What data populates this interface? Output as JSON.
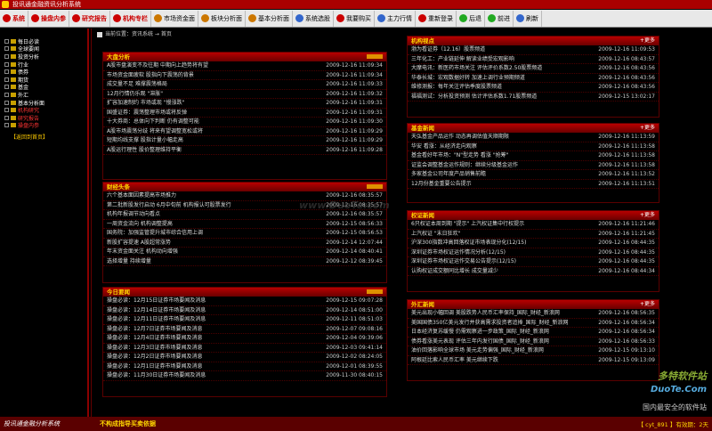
{
  "window": {
    "title": "投讯通金融资讯分析系统"
  },
  "toolbar": [
    {
      "label": "系统",
      "color": "#c00",
      "red": true
    },
    {
      "label": "操盘内参",
      "color": "#c00",
      "red": true
    },
    {
      "label": "研究报告",
      "color": "#c00",
      "red": true
    },
    {
      "label": "机构专栏",
      "color": "#c00",
      "red": true
    },
    {
      "label": "市场资金面",
      "color": "#c70",
      "red": false
    },
    {
      "label": "板块分析面",
      "color": "#c70",
      "red": false
    },
    {
      "label": "基本分析面",
      "color": "#c70",
      "red": false
    },
    {
      "label": "系统选股",
      "color": "#36c",
      "red": false
    },
    {
      "label": "我要购买",
      "color": "#c00",
      "red": false
    },
    {
      "label": "主力行情",
      "color": "#36c",
      "red": false
    },
    {
      "label": "重新登录",
      "color": "#c00",
      "red": false
    },
    {
      "label": "后退",
      "color": "#2a2",
      "red": false
    },
    {
      "label": "前进",
      "color": "#2a2",
      "red": false
    },
    {
      "label": "刷新",
      "color": "#36c",
      "red": false
    }
  ],
  "sidebar": {
    "items": [
      {
        "label": "每日必读",
        "red": false
      },
      {
        "label": "全球要闻",
        "red": false
      },
      {
        "label": "投资分析",
        "red": false
      },
      {
        "label": "行业",
        "red": false
      },
      {
        "label": "债券",
        "red": false
      },
      {
        "label": "期货",
        "red": false
      },
      {
        "label": "基金",
        "red": false
      },
      {
        "label": "外汇",
        "red": false
      },
      {
        "label": "基本分析面",
        "red": false
      },
      {
        "label": "机构研究",
        "red": true
      },
      {
        "label": "研究报告",
        "red": true
      },
      {
        "label": "操盘内参",
        "red": true
      }
    ],
    "back_link": "【返回到首页】"
  },
  "breadcrumb": {
    "text": "当前位置：资讯系统 → 首页"
  },
  "panels": {
    "dapan": {
      "title": "大盘分析",
      "more": "",
      "rows": [
        {
          "t": "A股市盘演变不及往期 中期向上趋势将有望",
          "d": "2009-12-16 11:09:34"
        },
        {
          "t": "市场资金面疲软 股指向下震荡的背景",
          "d": "2009-12-16 11:09:34"
        },
        {
          "t": "成交量不足 难撑震荡格局",
          "d": "2009-12-16 11:09:33"
        },
        {
          "t": "12月行情仍乐观 \"滞胀\"",
          "d": "2009-12-16 11:09:32"
        },
        {
          "t": "扩容加速制约 市场或现 \"慢涨跌\"",
          "d": "2009-12-16 11:09:31"
        },
        {
          "t": "国盛证券：震荡整理市场或将反弹",
          "d": "2009-12-16 11:09:31"
        },
        {
          "t": "十大券商：总体向下判断 仍有调整可能",
          "d": "2009-12-16 11:09:30"
        },
        {
          "t": "A股市场震荡分歧 将来有望调整宽松或将",
          "d": "2009-12-16 11:09:29"
        },
        {
          "t": "短期均线支撑 股指计量小幅走高",
          "d": "2009-12-16 11:09:29"
        },
        {
          "t": "A股运行理性 股价整理维持平衡",
          "d": "2009-12-16 11:09:28"
        }
      ]
    },
    "caijing": {
      "title": "财经头条",
      "more": "",
      "rows": [
        {
          "t": "六个基本面因素提高市场推力",
          "d": "2009-12-16 08:35:57"
        },
        {
          "t": "第二批新股发行启动 6月中旬前 机构报认可股票发行",
          "d": "2009-12-16 08:35:57"
        },
        {
          "t": "机构年报调节动向看点",
          "d": "2009-12-16 08:35:57"
        },
        {
          "t": "一周资金流向 机构调整提高",
          "d": "2009-12-15 08:56:33"
        },
        {
          "t": "国务院：加强监管提升城市综合信用上调",
          "d": "2009-12-15 08:56:53"
        },
        {
          "t": "新股扩容提速 A股超常涨势",
          "d": "2009-12-14 12:07:44"
        },
        {
          "t": "年末资金面关注 机构动向增强",
          "d": "2009-12-14 08:40:41"
        },
        {
          "t": "选择增量 持续增量",
          "d": "2009-12-12 08:39:45"
        }
      ]
    },
    "jinri": {
      "title": "今日要闻",
      "more": "",
      "rows": [
        {
          "t": "操盘必读：12月15日证券市场要闻及消息",
          "d": "2009-12-15 09:07:28"
        },
        {
          "t": "操盘必读：12月14日证券市场要闻及消息",
          "d": "2009-12-14 08:51:00"
        },
        {
          "t": "操盘必读：12月11日证券市场要闻及消息",
          "d": "2009-12-11 08:51:03"
        },
        {
          "t": "操盘必读：12月7日证券市场要闻及消息",
          "d": "2009-12-07 09:08:16"
        },
        {
          "t": "操盘必读：12月4日证券市场要闻及消息",
          "d": "2009-12-04 09:39:06"
        },
        {
          "t": "操盘必读：12月3日证券市场要闻及消息",
          "d": "2009-12-03 09:41:14"
        },
        {
          "t": "操盘必读：12月2日证券市场要闻及消息",
          "d": "2009-12-02 08:24:05"
        },
        {
          "t": "操盘必读：12月1日证券市场要闻及消息",
          "d": "2009-12-01 08:39:55"
        },
        {
          "t": "操盘必读：11月30日证券市场要闻及消息",
          "d": "2009-11-30 08:40:15"
        }
      ]
    },
    "jigou": {
      "title": "机构视点",
      "more": "+更多",
      "rows": [
        {
          "t": "渤为看证券（12.16）股票频道",
          "d": "2009-12-16 11:09:53"
        },
        {
          "t": "三年化工：产业链延伸 解读业绩受宏观影响",
          "d": "2009-12-16 08:43:57"
        },
        {
          "t": "大摩电讯：新医药市场关注 评估评价系数2.50股票频道",
          "d": "2009-12-16 08:43:56"
        },
        {
          "t": "华泰长城：宏观数据好转 加速上调行业预期频道",
          "d": "2009-12-16 08:43:56"
        },
        {
          "t": "维修测报：每年关注评估季度股票频道",
          "d": "2009-12-16 08:43:56"
        },
        {
          "t": "福福测试：分析投资预测 估计评估系数1.71股票频道",
          "d": "2009-12-15 13:02:17"
        }
      ]
    },
    "jijin": {
      "title": "基金新闻",
      "more": "+更多",
      "rows": [
        {
          "t": "天弘基金产品运作 动态再调估值天顺期限",
          "d": "2009-12-16 11:13:59"
        },
        {
          "t": "华安 看涨：从经济走向观察",
          "d": "2009-12-16 11:13:58"
        },
        {
          "t": "基金看好年市场：\"N\"型走势 看涨 \"抢筹\"",
          "d": "2009-12-16 11:13:58"
        },
        {
          "t": "证监会调整基金运作规则：继续分级基金运作",
          "d": "2009-12-16 11:13:58"
        },
        {
          "t": "多家基金公司年度产品销售前瞻",
          "d": "2009-12-16 11:13:52"
        },
        {
          "t": "12月份基金重要公告提示",
          "d": "2009-12-16 11:13:51"
        }
      ]
    },
    "quanshang": {
      "title": "权证新闻",
      "more": "+更多",
      "rows": [
        {
          "t": "6只权证本周到期 \"提示\" 上汽权证集中行权提示",
          "d": "2009-12-16 11:21:46"
        },
        {
          "t": "上汽权证 \"末日狂欢\"",
          "d": "2009-12-16 11:21:45"
        },
        {
          "t": "沪深300指数冲高回落权证市场表现分化(12/15)",
          "d": "2009-12-16 08:44:35"
        },
        {
          "t": "深圳证券市场权证运作情况分析(12/15)",
          "d": "2009-12-16 08:44:35"
        },
        {
          "t": "深圳证券市场权证运作交易公告提示(12/15)",
          "d": "2009-12-16 08:44:35"
        },
        {
          "t": "认购权证成交额同比增长 成交量减少",
          "d": "2009-12-16 08:44:34"
        }
      ]
    },
    "waihui": {
      "title": "外汇新闻",
      "more": "+更多",
      "rows": [
        {
          "t": "美元出现小幅回调 美股跌势人民币汇率保持_国际_财经_新浪网",
          "d": "2009-12-16 08:56:35"
        },
        {
          "t": "美国国债350亿美元发行并获高需求投资者追捧_国际_财经_新浪网",
          "d": "2009-12-16 08:56:34"
        },
        {
          "t": "日本经济复苏缓慢 仍需观察进一步政策_国际_财经_新浪网",
          "d": "2009-12-16 08:56:34"
        },
        {
          "t": "债券看涨美元表现 评估三年内发行国债_国际_财经_新浪网",
          "d": "2009-12-16 08:56:33"
        },
        {
          "t": "油价回落影响全球市场 美元走势偏强_国际_财经_新浪网",
          "d": "2009-12-15 09:13:10"
        },
        {
          "t": "阿根廷比索人民币汇率 美元继续下跌",
          "d": "2009-12-15 09:13:09"
        }
      ]
    }
  },
  "watermarks": {
    "center": "www.DuoTe.com",
    "br_line1": "多特软件站",
    "br_line2": "DuoTe.Com",
    "br_line3": "国内最安全的软件站"
  },
  "status": {
    "left": "投讯通金融分析系统",
    "message": "不构成指导买卖依据",
    "right": "【 cyt_891 】有效期：2天"
  }
}
